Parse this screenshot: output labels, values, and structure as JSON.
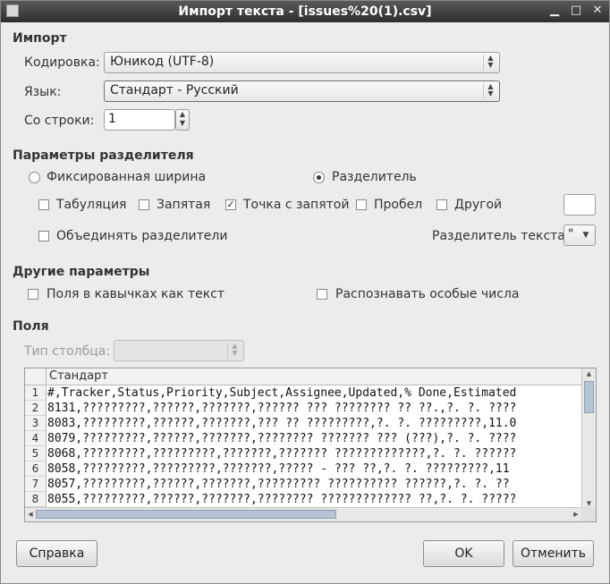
{
  "window": {
    "title": "Импорт текста - [issues%20(1).csv]",
    "controls": [
      "▁",
      "□",
      "✕"
    ]
  },
  "import_section": {
    "heading": "Импорт",
    "encoding_label": "Кодировка:",
    "encoding_value": "Юникод (UTF-8)",
    "language_label": "Язык:",
    "language_value": "Стандарт - Русский",
    "from_row_label": "Со строки:",
    "from_row_value": "1"
  },
  "separator_section": {
    "heading": "Параметры разделителя",
    "fixed_width_label": "Фиксированная ширина",
    "separated_label": "Разделитель",
    "tab_label": "Табуляция",
    "comma_label": "Запятая",
    "semicolon_label": "Точка с запятой",
    "space_label": "Пробел",
    "other_label": "Другой",
    "merge_label": "Объединять разделители",
    "text_delimiter_label": "Разделитель текста:",
    "text_delimiter_value": "\""
  },
  "other_section": {
    "heading": "Другие параметры",
    "quoted_as_text_label": "Поля в кавычках как текст",
    "detect_special_label": "Распознавать особые числа"
  },
  "fields_section": {
    "heading": "Поля",
    "column_type_label": "Тип столбца:",
    "column_header": "Стандарт",
    "rows": [
      "#,Tracker,Status,Priority,Subject,Assignee,Updated,% Done,Estimated",
      "8131,?????????,??????,???????,?????? ??? ???????? ?? ??.,?. ?. ????",
      "8083,?????????,??????,???????,??? ?? ?????????,?. ?. ?????????,11.0",
      "8079,?????????,??????,???????,???????? ??????? ??? (???),?. ?. ????",
      "8068,?????????,?????????,???????,??????? ?????????????,?. ?. ??????",
      "8058,?????????,?????????,???????,????? - ??? ??,?. ?. ?????????,11",
      "8057,?????????,??????,???????,????????? ?????????? ??????,?. ?. ??",
      "8055,?????????,??????,???????,???????? ????????????? ??,?. ?. ?????"
    ]
  },
  "buttons": {
    "help": "Справка",
    "ok": "OK",
    "cancel": "Отменить"
  }
}
